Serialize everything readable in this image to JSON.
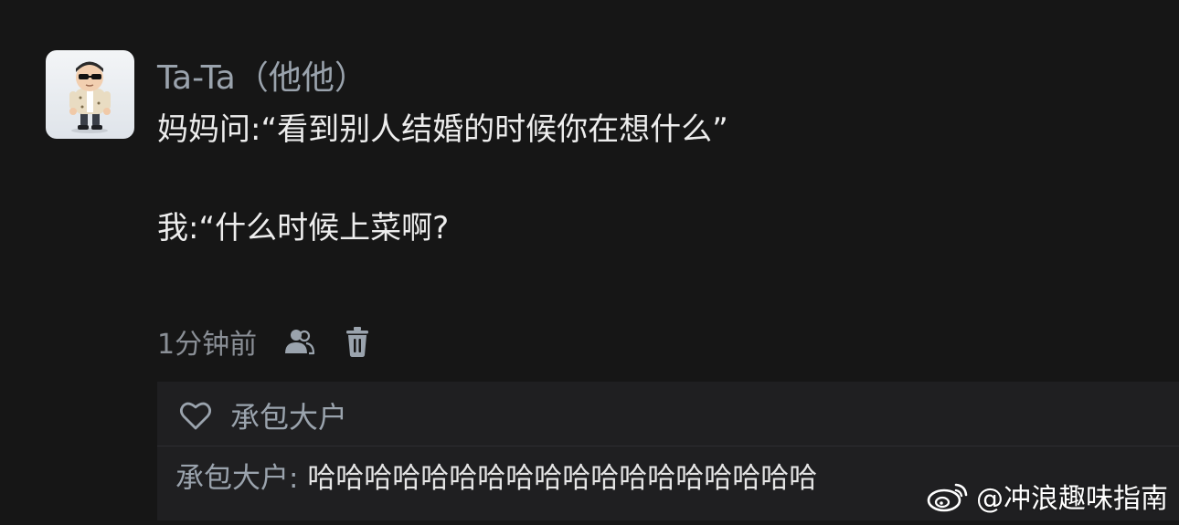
{
  "post": {
    "author": "Ta-Ta（他他）",
    "lines": [
      "妈妈问:“看到别人结婚的时候你在想什么”",
      "我:“什么时候上菜啊?"
    ],
    "time": "1分钟前",
    "icons": {
      "people": "people-icon",
      "delete": "trash-icon"
    }
  },
  "likes": {
    "icon": "heart-icon",
    "liker": "承包大户"
  },
  "reply": {
    "author": "承包大户",
    "separator": ": ",
    "text": "哈哈哈哈哈哈哈哈哈哈哈哈哈哈哈哈哈哈"
  },
  "watermark": {
    "icon": "weibo-logo-icon",
    "text": "@冲浪趣味指南"
  },
  "colors": {
    "background": "#161616",
    "panel": "#1f1f21",
    "name": "#9aa3ad",
    "text": "#ededed",
    "muted": "#8a8f96"
  }
}
